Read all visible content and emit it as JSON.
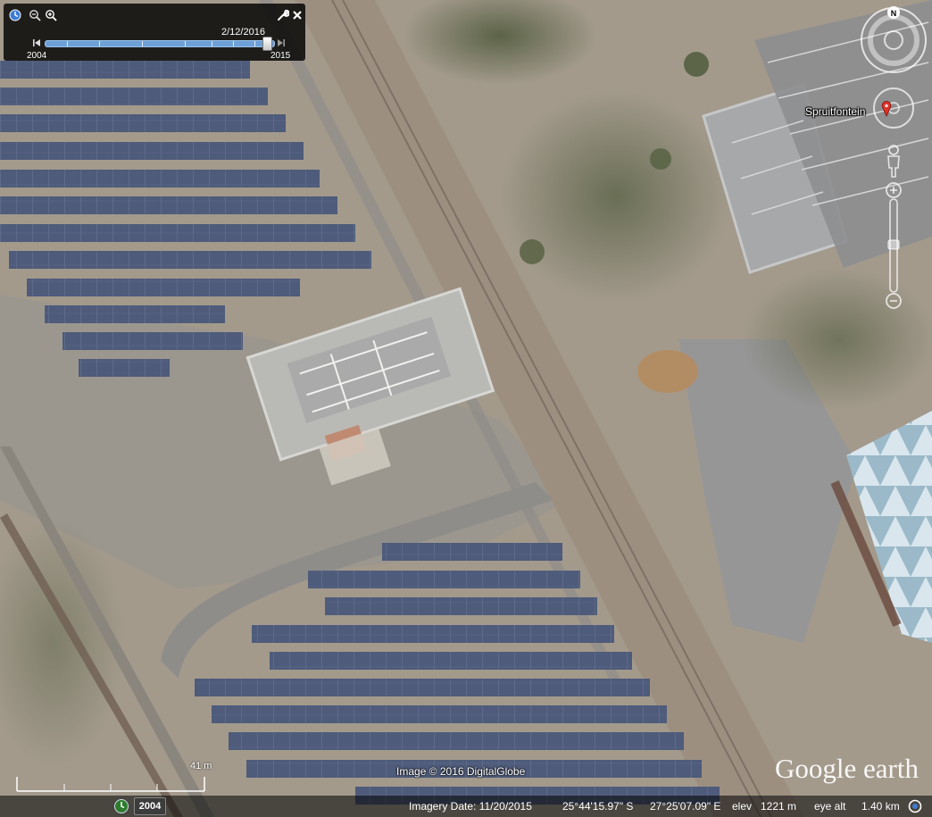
{
  "time_slider": {
    "current_date": "2/12/2016",
    "start_year": "2004",
    "end_year": "2015",
    "position": 0.97
  },
  "map": {
    "place_label": "Spruitfontein",
    "scale_label": "41 m",
    "copyright": "Image © 2016 DigitalGlobe",
    "logo_text": "Google earth"
  },
  "status_bar": {
    "historical_year": "2004",
    "imagery_date": "Imagery Date: 11/20/2015",
    "latitude": "25°44'15.97\" S",
    "longitude": "27°25'07.09\" E",
    "elev_label": "elev",
    "elevation": "1221 m",
    "eye_alt_label": "eye alt",
    "eye_altitude": "1.40 km"
  },
  "icons": {
    "clock": "clock-icon",
    "zoom_out": "zoom-out-icon",
    "zoom_in": "zoom-in-icon",
    "settings": "wrench-icon",
    "close": "close-icon",
    "compass": "compass-icon",
    "pin": "map-pin-icon",
    "pegman": "pegman-icon",
    "streaming": "streaming-status-icon"
  },
  "colors": {
    "ground": "#a39a8c",
    "solar_panel": "#4e5b7a",
    "road": "#9a8a78",
    "pin": "#e0312a",
    "slider": "#6ea0d8"
  },
  "compass_letter": "N"
}
